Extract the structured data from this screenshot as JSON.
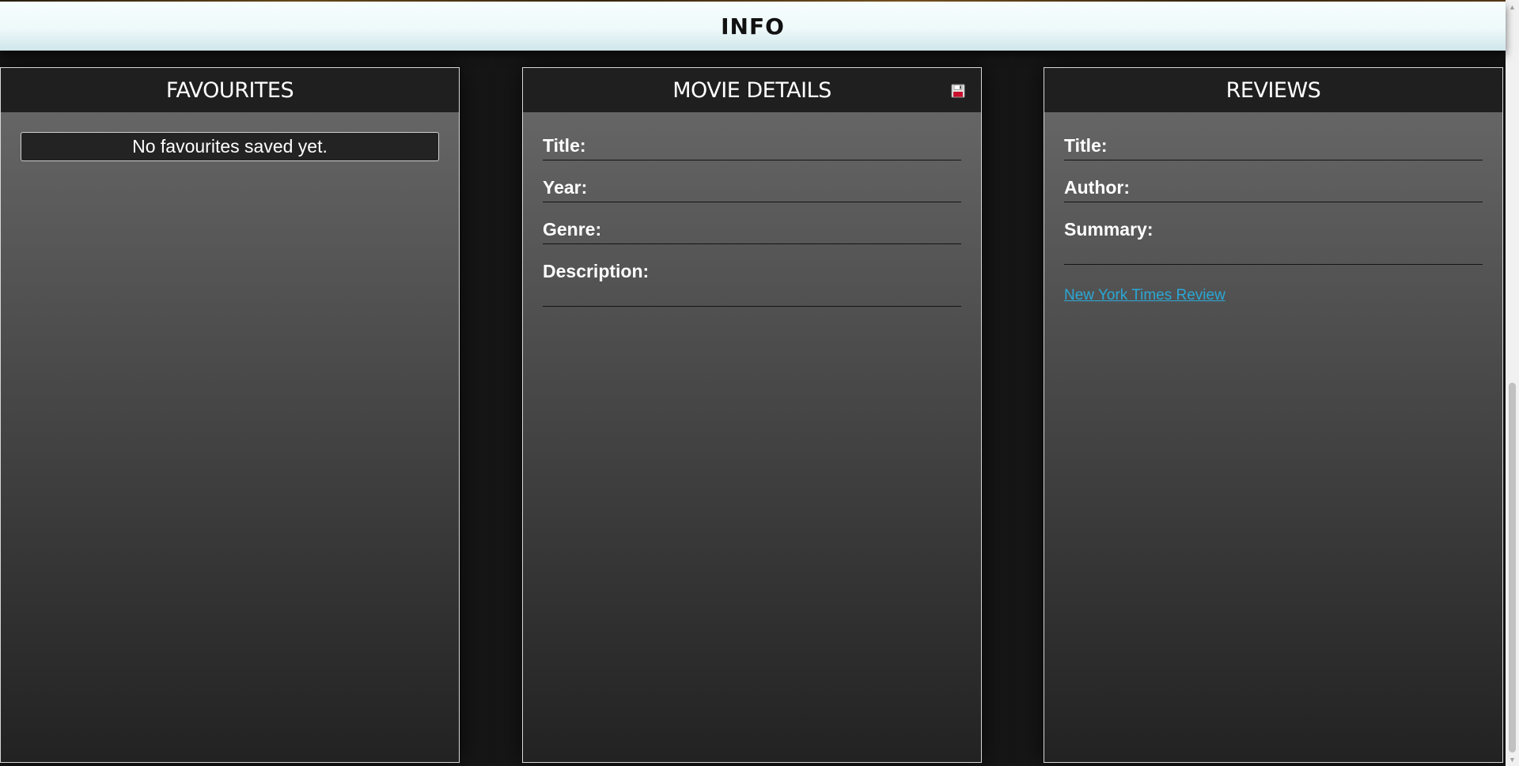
{
  "header": {
    "title": "INFO"
  },
  "favourites": {
    "title": "FAVOURITES",
    "empty_message": "No favourites saved yet."
  },
  "movie_details": {
    "title": "MOVIE DETAILS",
    "save_icon": "save-icon",
    "fields": {
      "title": "Title:",
      "year": "Year:",
      "genre": "Genre:",
      "description": "Description:"
    }
  },
  "reviews": {
    "title": "REVIEWS",
    "fields": {
      "title": "Title:",
      "author": "Author:",
      "summary": "Summary:"
    },
    "link_label": "New York Times Review"
  },
  "colors": {
    "header_bg": "#eef9fa",
    "panel_header_bg": "#1f1f1f",
    "link": "#2aa8d6"
  }
}
